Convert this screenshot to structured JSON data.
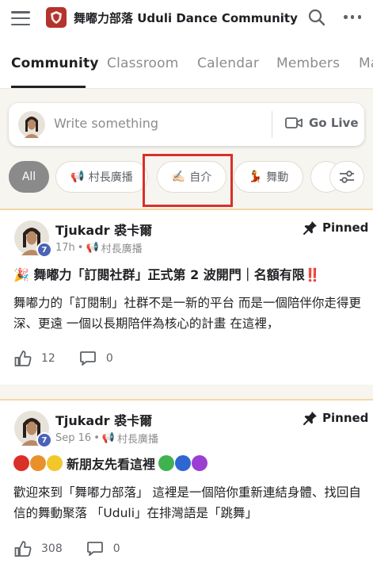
{
  "header": {
    "title": "舞嘟力部落 Uduli Dance Community",
    "menu_icon": "hamburger-icon",
    "search_icon": "search-icon",
    "more_icon": "more-horizontal-icon"
  },
  "tabs": [
    {
      "label": "Community",
      "active": true
    },
    {
      "label": "Classroom",
      "active": false
    },
    {
      "label": "Calendar",
      "active": false
    },
    {
      "label": "Members",
      "active": false
    },
    {
      "label": "Ma",
      "active": false
    }
  ],
  "composer": {
    "placeholder": "Write something",
    "go_live_label": "Go Live"
  },
  "filter_chips": [
    {
      "label": "All",
      "emoji": "",
      "selected": true
    },
    {
      "label": "村長廣播",
      "emoji": "📢",
      "selected": false
    },
    {
      "label": "自介",
      "emoji": "✍🏻",
      "selected": false
    },
    {
      "label": "舞動",
      "emoji": "💃",
      "selected": false
    }
  ],
  "posts": [
    {
      "author": "Tjukadr 裘卡爾",
      "level": "7",
      "time": "17h",
      "category": "村長廣播",
      "category_emoji": "📢",
      "pinned_label": "Pinned",
      "title_prefix": "🎉",
      "title": "舞嘟力「訂閱社群」正式第 2 波開門｜名額有限",
      "title_suffix": "‼️",
      "body": "舞嘟力的「訂閱制」社群不是一新的平台 而是一個陪伴你走得更深、更遠 一個以長期陪伴為核心的計畫 在這裡，",
      "likes": "12",
      "comments": "0"
    },
    {
      "author": "Tjukadr 裘卡爾",
      "level": "7",
      "time": "Sep 16",
      "category": "村長廣播",
      "category_emoji": "📢",
      "pinned_label": "Pinned",
      "title": "新朋友先看這裡",
      "title_circles_left": [
        "#d9302a",
        "#e8912b",
        "#f2c72b"
      ],
      "title_circles_right": [
        "#3fb34f",
        "#2f66d4",
        "#9b3fd4"
      ],
      "body": "歡迎來到「舞嘟力部落」 這裡是一個陪你重新連結身體、找回自信的舞動聚落 「Uduli」在排灣語是「跳舞」",
      "likes": "308",
      "comments": "0"
    }
  ],
  "colors": {
    "brand_red": "#b3342b",
    "highlight_red": "#d9302a",
    "level_badge": "#4a63b8",
    "selected_chip": "#8a8a8a"
  }
}
